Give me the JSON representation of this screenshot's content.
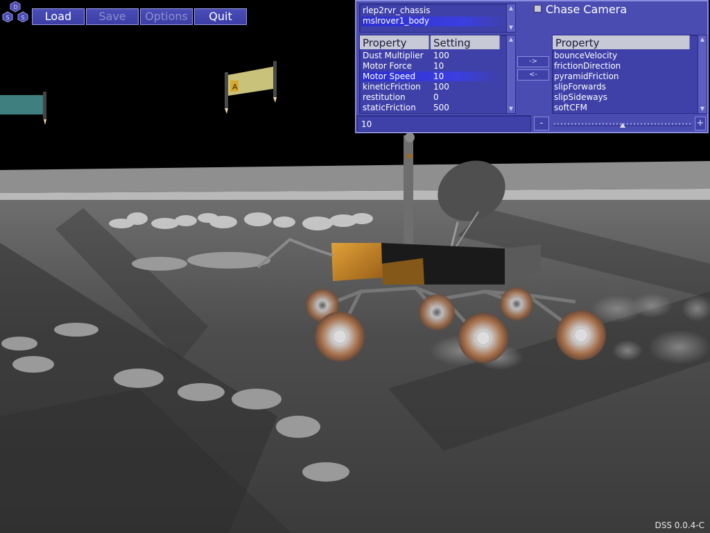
{
  "logo": {
    "letters": [
      "D",
      "S",
      "S"
    ]
  },
  "menu": {
    "load": "Load",
    "save": "Save",
    "options": "Options",
    "quit": "Quit"
  },
  "panel": {
    "objects": [
      "rlep2rvr_chassis",
      "mslrover1_body"
    ],
    "selected_object": "mslrover1_body",
    "chase_camera": {
      "label": "Chase Camera",
      "checked": false
    },
    "left_table": {
      "headers": [
        "Property",
        "Setting"
      ],
      "rows": [
        {
          "property": "Dust Multiplier",
          "setting": "100"
        },
        {
          "property": "Motor Force",
          "setting": "10"
        },
        {
          "property": "Motor Speed",
          "setting": "10"
        },
        {
          "property": "kineticFriction",
          "setting": "100"
        },
        {
          "property": "restitution",
          "setting": "0"
        },
        {
          "property": "staticFriction",
          "setting": "500"
        }
      ],
      "selected_row": "Motor Speed"
    },
    "move_right": "->",
    "move_left": "<-",
    "right_table": {
      "header": "Property",
      "items": [
        "bounceVelocity",
        "frictionDirection",
        "pyramidFriction",
        "slipForwards",
        "slipSideways",
        "softCFM"
      ]
    },
    "value_input": "10",
    "decrement": "-",
    "increment": "+",
    "slider_value_fraction": 0.5
  },
  "signs": {
    "yellow_icon": "A"
  },
  "version": "DSS 0.0.4-C"
}
